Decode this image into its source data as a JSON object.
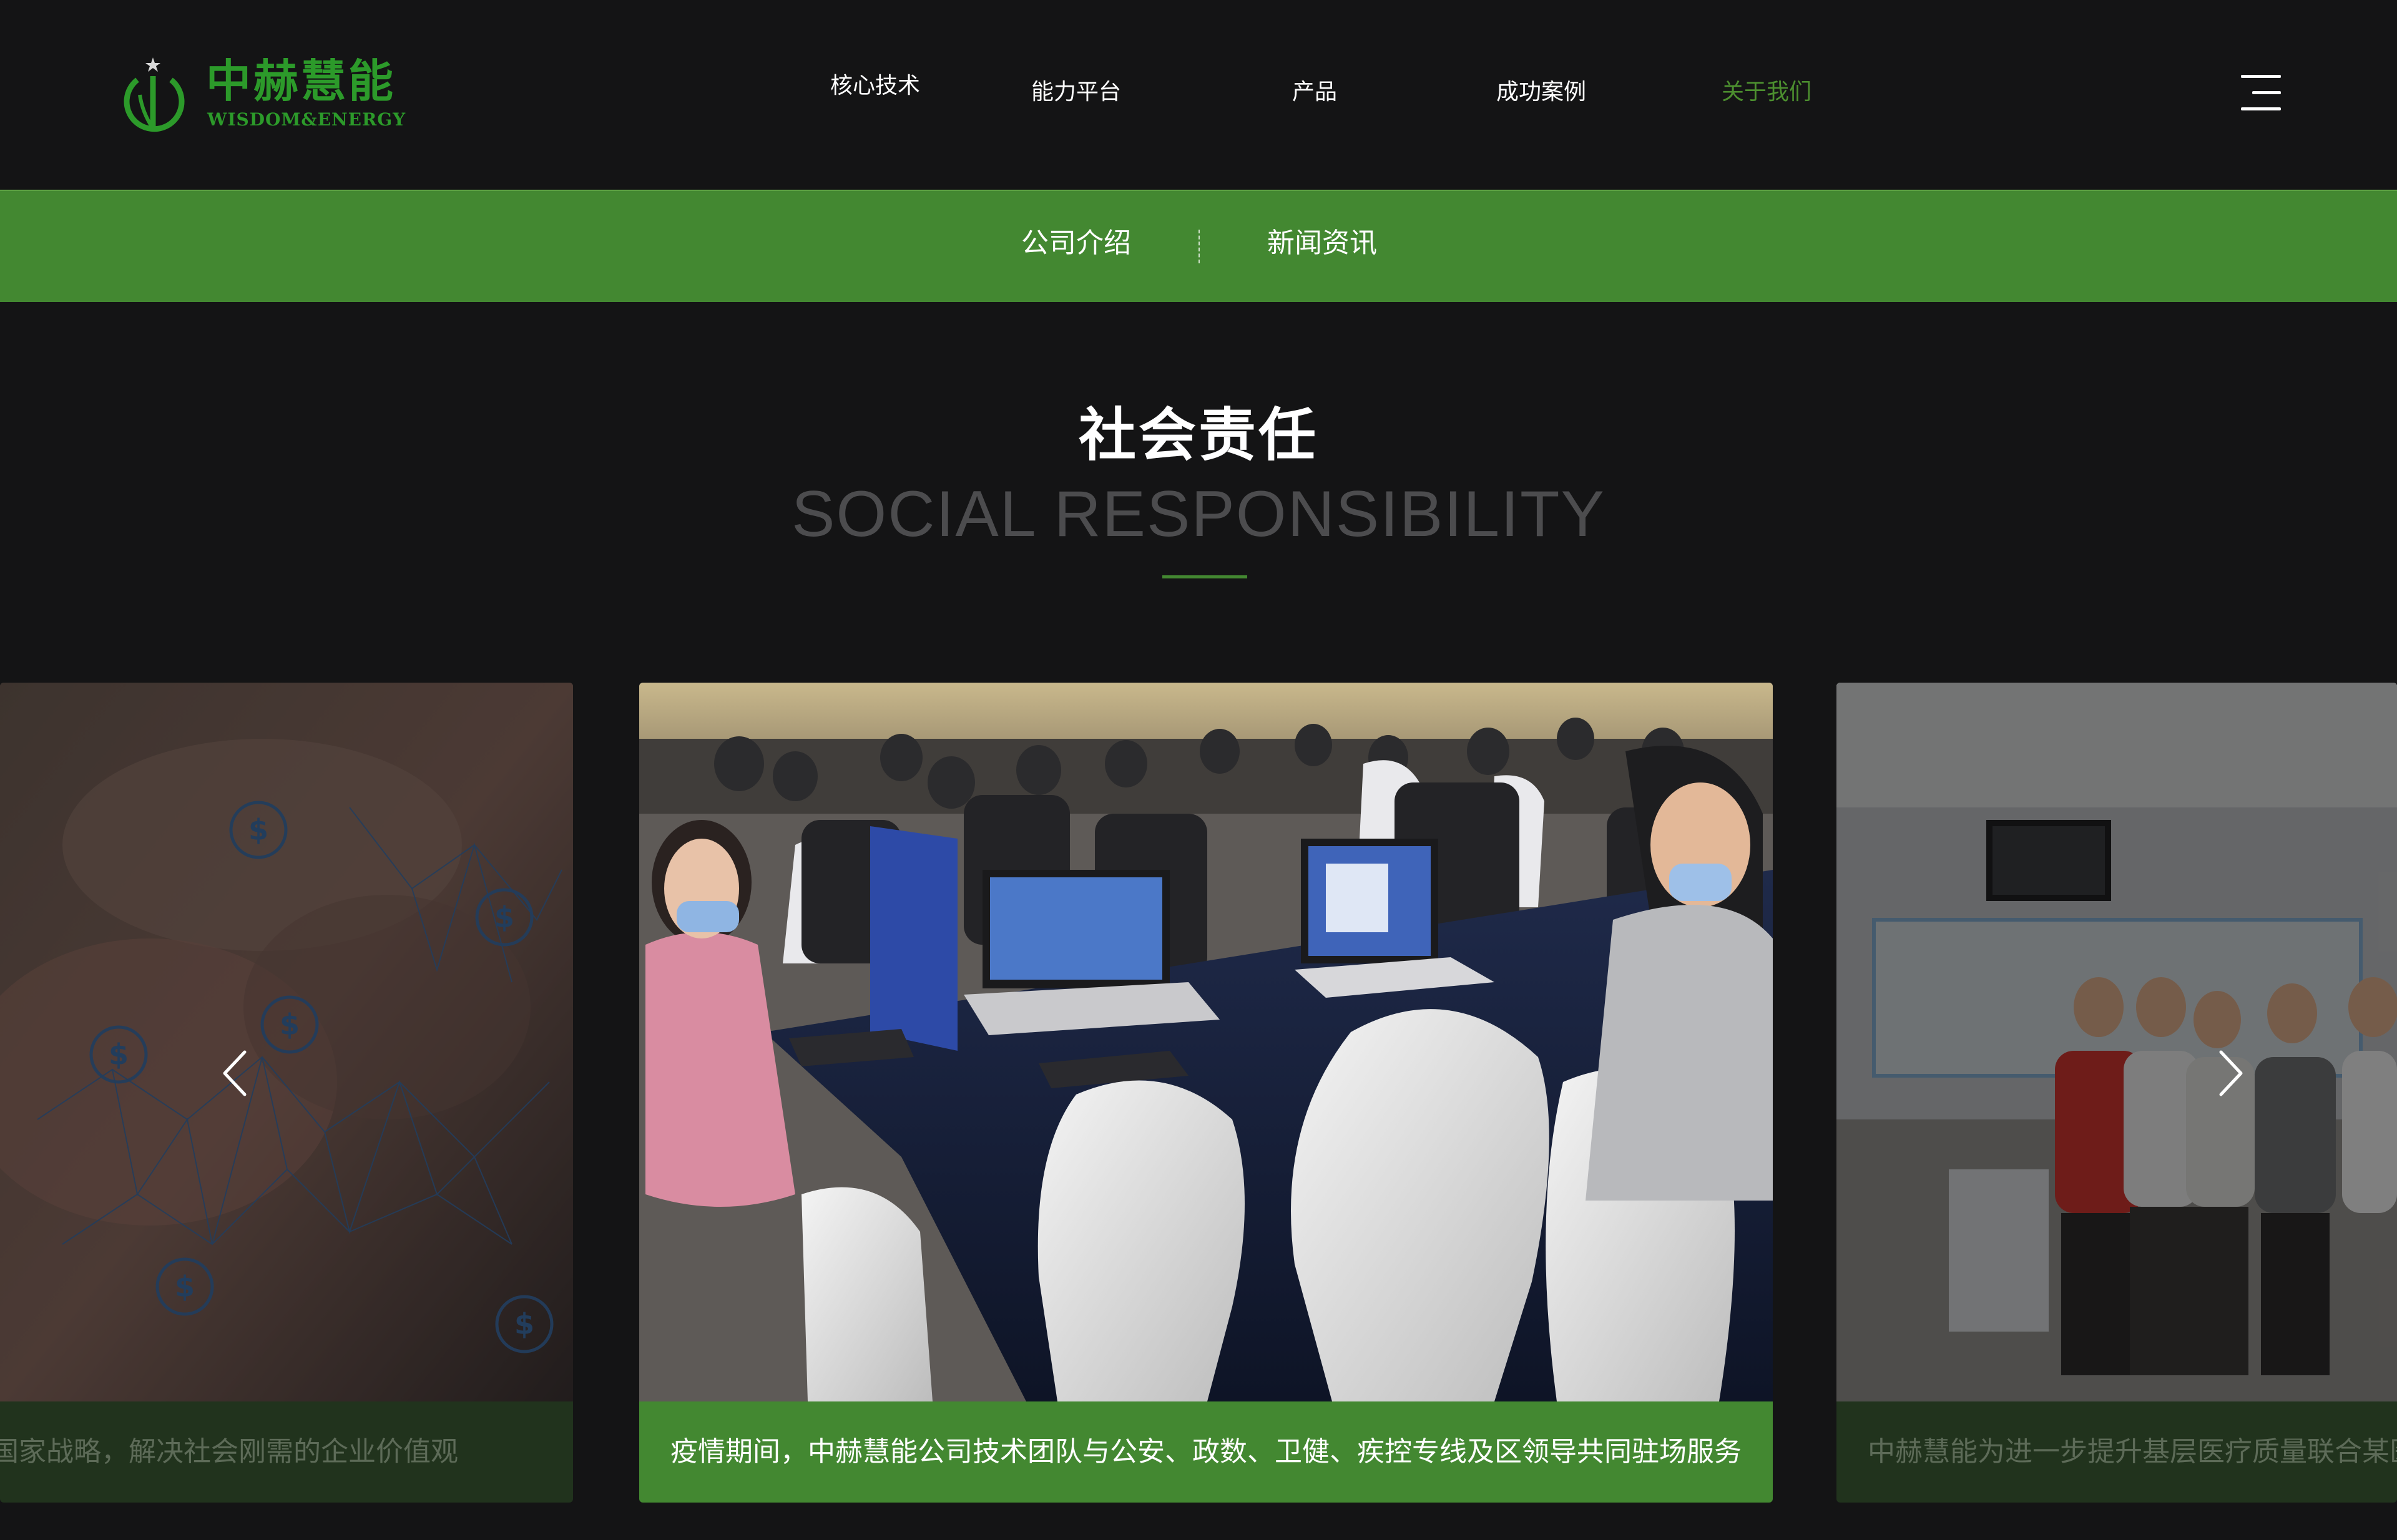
{
  "brand": {
    "name_cn": "中赫慧能",
    "name_en": "WISDOM&ENERGY",
    "color": "#2c9a2a"
  },
  "nav": {
    "items": [
      {
        "label": "核心技术",
        "active": false
      },
      {
        "label": "能力平台",
        "active": false
      },
      {
        "label": "产品",
        "active": false
      },
      {
        "label": "成功案例",
        "active": false
      },
      {
        "label": "关于我们",
        "active": true
      }
    ],
    "menu_icon": "hamburger-menu-icon",
    "active_color": "#4c8f2f"
  },
  "subnav": {
    "background": "#438831",
    "items": [
      {
        "label": "公司介绍"
      },
      {
        "label": "新闻资讯"
      }
    ]
  },
  "section": {
    "title": "社会责任",
    "subtitle": "SOCIAL RESPONSIBILITY"
  },
  "carousel": {
    "prev_icon": "chevron-left-icon",
    "next_icon": "chevron-right-icon",
    "slides": [
      {
        "caption": "国家战略，解决社会刚需的企业价值观",
        "image": "hands-network-dollar-image",
        "active": false
      },
      {
        "caption": "疫情期间，中赫慧能公司技术团队与公安、政数、卫健、疾控专线及区领导共同驻场服务",
        "image": "team-working-laptops-image",
        "active": true
      },
      {
        "caption": "中赫慧能为进一步提升基层医疗质量联合某医",
        "image": "group-photo-clinic-image",
        "active": false
      }
    ]
  }
}
